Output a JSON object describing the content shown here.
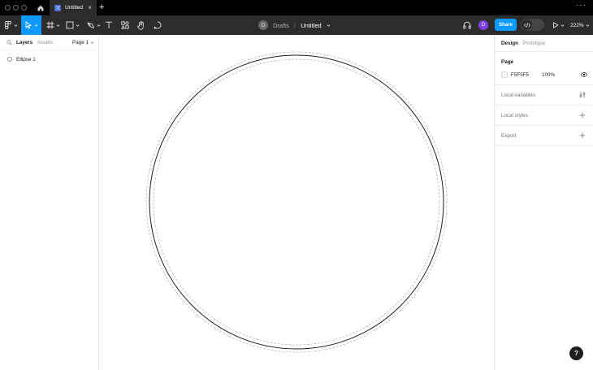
{
  "titlebar": {
    "tab_label": "Untitled",
    "close_glyph": "×",
    "new_tab_glyph": "+",
    "more_glyph": "···"
  },
  "toolbar": {
    "breadcrumb_avatar": "D",
    "breadcrumb_team": "Drafts",
    "breadcrumb_sep": "/",
    "file_name": "Untitled",
    "user_avatar": "D",
    "share_label": "Share",
    "zoom_level": "222%",
    "accent": "#0d99ff"
  },
  "left_panel": {
    "tabs": [
      "Layers",
      "Assets"
    ],
    "page_selector": "Page 1",
    "layers": [
      {
        "name": "Ellipse 1",
        "icon": "ellipse-icon"
      }
    ]
  },
  "right_panel": {
    "tabs": [
      "Design",
      "Prototype"
    ],
    "page": {
      "title": "Page",
      "background_hex": "F5F5F5",
      "opacity": "100%",
      "visibility_icon": "eye-icon"
    },
    "rows": [
      {
        "label": "Local variables",
        "icon": "variables-icon"
      },
      {
        "label": "Local styles",
        "icon": "plus-icon"
      },
      {
        "label": "Export",
        "icon": "plus-icon"
      }
    ]
  },
  "help": {
    "label": "?"
  }
}
